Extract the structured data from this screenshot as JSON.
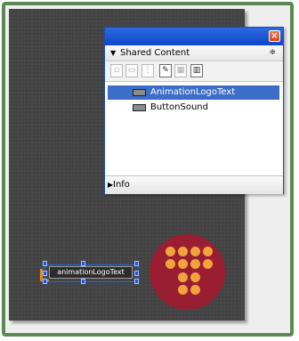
{
  "panel": {
    "title": "Shared Content",
    "close_glyph": "×",
    "menu_glyph": "≑",
    "toolbar_icons": [
      "new-symbol-icon",
      "folder-icon",
      "properties-icon",
      "edit-icon",
      "library-icon",
      "trash-icon"
    ],
    "items": [
      {
        "label": "AnimationLogoText",
        "selected": true
      },
      {
        "label": "ButtonSound",
        "selected": false
      }
    ],
    "footer_label": "Info"
  },
  "stage": {
    "text_object_value": "animationLogoText"
  },
  "colors": {
    "titlebar": "#1f5ad8",
    "selection": "#3c6dc8",
    "stage": "#434343",
    "button_fill": "#9a1e32",
    "button_dots": "#f2a33c"
  }
}
